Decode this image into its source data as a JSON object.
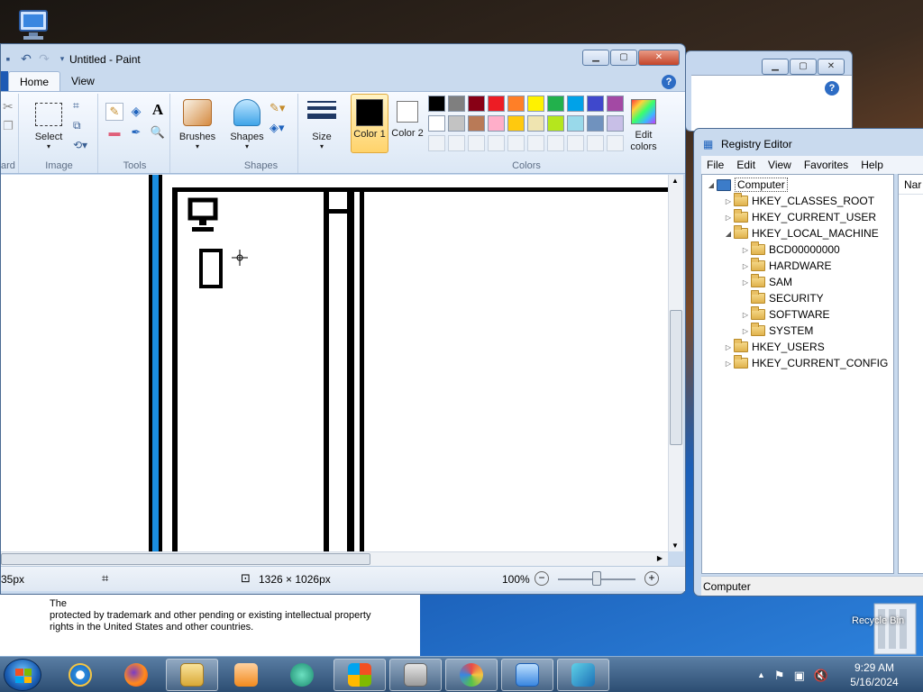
{
  "paint": {
    "title": "Untitled - Paint",
    "tabs": [
      "Home",
      "View"
    ],
    "groups": {
      "clipboard_partial": "ard",
      "image": "Image",
      "tools": "Tools",
      "shapes": "Shapes",
      "colors": "Colors"
    },
    "buttons": {
      "select": "Select",
      "brushes": "Brushes",
      "shapes": "Shapes",
      "size": "Size",
      "color1": "Color 1",
      "color2": "Color 2",
      "edit_colors": "Edit colors"
    },
    "palette_row1": [
      "#000000",
      "#7f7f7f",
      "#880015",
      "#ed1c24",
      "#ff7f27",
      "#fff200",
      "#22b14c",
      "#00a2e8",
      "#3f48cc",
      "#a349a4"
    ],
    "palette_row2": [
      "#ffffff",
      "#c3c3c3",
      "#b97a57",
      "#ffaec9",
      "#ffc90e",
      "#efe4b0",
      "#b5e61d",
      "#99d9ea",
      "#7092be",
      "#c8bfe7"
    ],
    "status": {
      "position": "35px",
      "canvas_size": "1326 × 1026px",
      "zoom": "100%"
    }
  },
  "registry": {
    "title": "Registry Editor",
    "menu": [
      "File",
      "Edit",
      "View",
      "Favorites",
      "Help"
    ],
    "column_partial": "Nar",
    "tree": [
      {
        "label": "Computer",
        "level": 0,
        "expanded": true
      },
      {
        "label": "HKEY_CLASSES_ROOT",
        "level": 1
      },
      {
        "label": "HKEY_CURRENT_USER",
        "level": 1
      },
      {
        "label": "HKEY_LOCAL_MACHINE",
        "level": 1,
        "expanded": true
      },
      {
        "label": "BCD00000000",
        "level": 2
      },
      {
        "label": "HARDWARE",
        "level": 2
      },
      {
        "label": "SAM",
        "level": 2
      },
      {
        "label": "SECURITY",
        "level": 2,
        "leaf": true
      },
      {
        "label": "SOFTWARE",
        "level": 2
      },
      {
        "label": "SYSTEM",
        "level": 2
      },
      {
        "label": "HKEY_USERS",
        "level": 1
      },
      {
        "label": "HKEY_CURRENT_CONFIG",
        "level": 1
      }
    ],
    "status": "Computer"
  },
  "desktop": {
    "recycle_bin": "Recycle Bin",
    "license_line1": "The",
    "license_line2": "protected by trademark and other pending or existing intellectual property",
    "license_line3": "rights in the United States and other countries."
  },
  "taskbar": {
    "time": "9:29 AM",
    "date": "5/16/2024"
  }
}
